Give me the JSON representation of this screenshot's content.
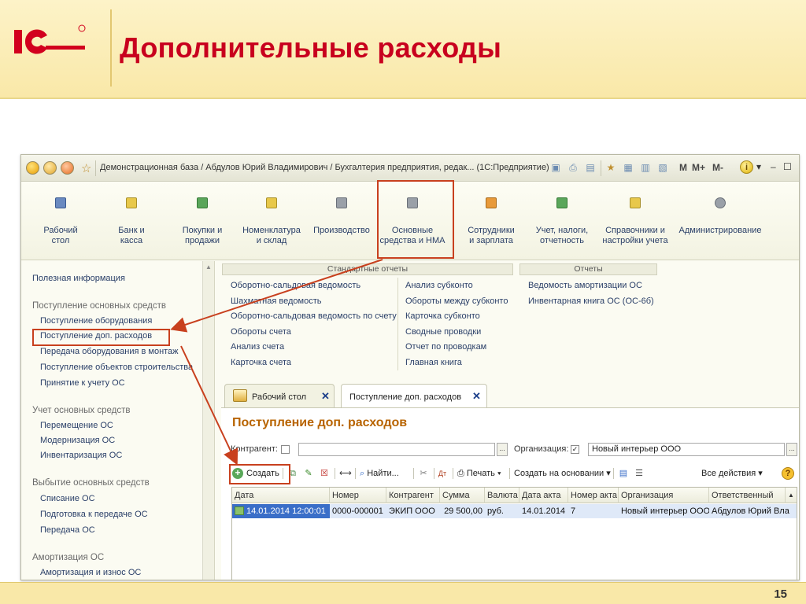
{
  "slide": {
    "title": "Дополнительные расходы",
    "page_number": "15",
    "logo_text": "1С"
  },
  "window": {
    "title": "Демонстрационная база / Абдулов Юрий Владимирович / Бухгалтерия предприятия, редак...  (1С:Предприятие)",
    "memory_buttons": [
      "M",
      "M+",
      "M-"
    ],
    "info_label": "i"
  },
  "sections": [
    {
      "line1": "Рабочий",
      "line2": "стол"
    },
    {
      "line1": "Банк и",
      "line2": "касса"
    },
    {
      "line1": "Покупки и",
      "line2": "продажи"
    },
    {
      "line1": "Номенклатура",
      "line2": "и склад"
    },
    {
      "line1": "Производство",
      "line2": ""
    },
    {
      "line1": "Основные",
      "line2": "средства и НМА"
    },
    {
      "line1": "Сотрудники",
      "line2": "и зарплата"
    },
    {
      "line1": "Учет, налоги,",
      "line2": "отчетность"
    },
    {
      "line1": "Справочники и",
      "line2": "настройки учета"
    },
    {
      "line1": "Администрирование",
      "line2": ""
    }
  ],
  "nav": {
    "useful_info": "Полезная информация",
    "group_receipt": "Поступление основных средств",
    "receipt_items": [
      "Поступление оборудования",
      "Поступление доп. расходов",
      "Передача оборудования в монтаж",
      "Поступление объектов строительства",
      "Принятие к учету ОС"
    ],
    "group_accounting": "Учет основных средств",
    "accounting_items": [
      "Перемещение ОС",
      "Модернизация ОС",
      "Инвентаризация ОС"
    ],
    "group_disposal": "Выбытие основных средств",
    "disposal_items": [
      "Списание ОС",
      "Подготовка к передаче ОС",
      "Передача ОС"
    ],
    "group_amortization": "Амортизация ОС",
    "amortization_items": [
      "Амортизация и износ ОС"
    ]
  },
  "reports": {
    "standard_title": "Стандартные отчеты",
    "col1": [
      "Оборотно-сальдовая ведомость",
      "Шахматная ведомость",
      "Оборотно-сальдовая ведомость по счету",
      "Обороты счета",
      "Анализ счета",
      "Карточка счета"
    ],
    "col2": [
      "Анализ субконто",
      "Обороты между субконто",
      "Карточка субконто",
      "Сводные проводки",
      "Отчет по проводкам",
      "Главная книга"
    ],
    "other_title": "Отчеты",
    "other": [
      "Ведомость амортизации ОС",
      "Инвентарная книга ОС (ОС-6б)"
    ]
  },
  "tabs": [
    {
      "label": "Рабочий стол",
      "close": "✕"
    },
    {
      "label": "Поступление доп. расходов",
      "close": "✕"
    }
  ],
  "form": {
    "title": "Поступление доп. расходов",
    "contractor_label": "Контрагент:",
    "contractor_value": "",
    "organization_label": "Организация:",
    "organization_checked": "✓",
    "organization_value": "Новый интерьер ООО",
    "ellipsis": "..."
  },
  "toolbar": {
    "create": "Создать",
    "find": "Найти...",
    "print": "Печать",
    "create_based_on": "Создать на основании",
    "all_actions": "Все действия",
    "help": "?"
  },
  "table": {
    "columns": [
      "Дата",
      "Номер",
      "Контрагент",
      "Сумма",
      "Валюта",
      "Дата акта",
      "Номер акта",
      "Организация",
      "Ответственный"
    ],
    "rows": [
      [
        "14.01.2014 12:00:01",
        "0000-000001",
        "ЭКИП ООО",
        "29 500,00",
        "руб.",
        "14.01.2014",
        "7",
        "Новый интерьер ООО",
        "Абдулов Юрий Вла"
      ]
    ]
  },
  "colors": {
    "title_red": "#c8001e",
    "annotation": "#c8401e",
    "form_title": "#b86400",
    "link_blue": "#2a3f68"
  }
}
